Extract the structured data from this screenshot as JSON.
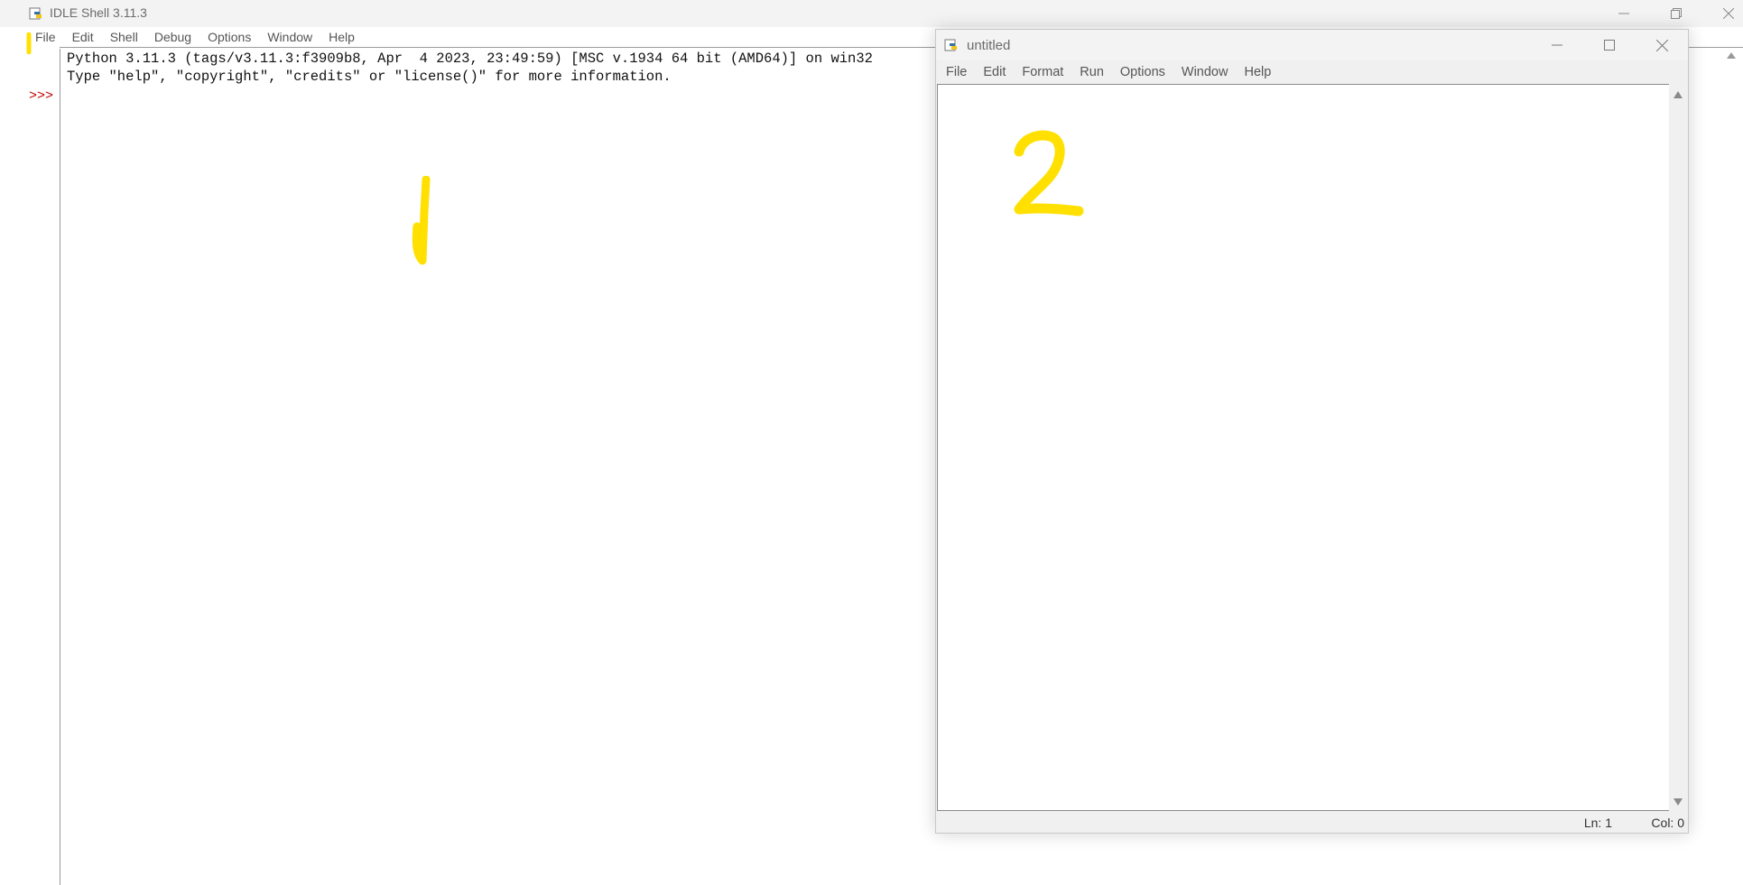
{
  "shell": {
    "title": "IDLE Shell 3.11.3",
    "menu": [
      "File",
      "Edit",
      "Shell",
      "Debug",
      "Options",
      "Window",
      "Help"
    ],
    "lines": [
      "Python 3.11.3 (tags/v3.11.3:f3909b8, Apr  4 2023, 23:49:59) [MSC v.1934 64 bit (AMD64)] on win32",
      "Type \"help\", \"copyright\", \"credits\" or \"license()\" for more information."
    ],
    "prompt": ">>>"
  },
  "editor": {
    "title": "untitled",
    "menu": [
      "File",
      "Edit",
      "Format",
      "Run",
      "Options",
      "Window",
      "Help"
    ],
    "status": {
      "line": "Ln: 1",
      "col": "Col: 0"
    }
  },
  "annotations": {
    "mark_1": "1",
    "mark_2": "2",
    "color": "#ffe000"
  },
  "colors": {
    "prompt": "#c00000",
    "titlebar": "#f3f3f3"
  }
}
